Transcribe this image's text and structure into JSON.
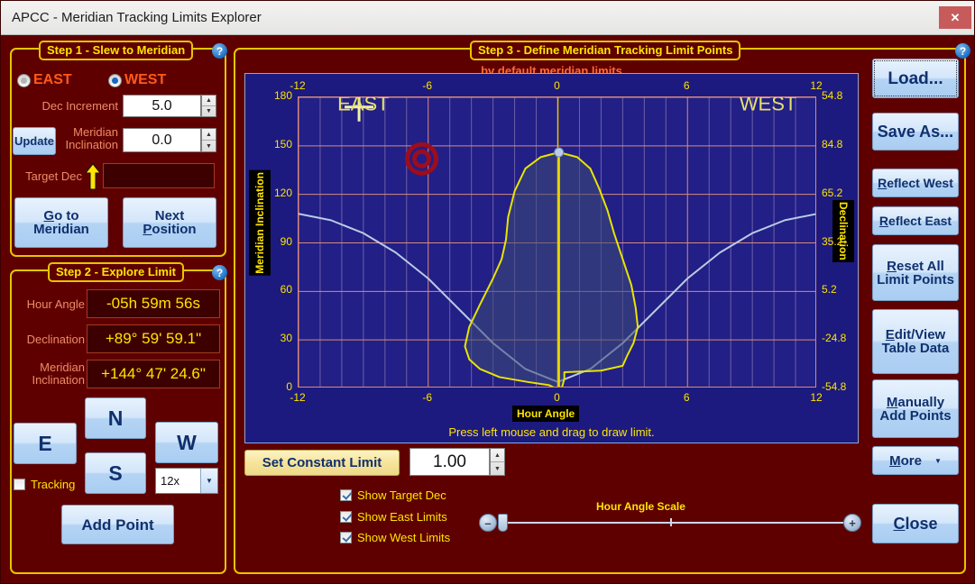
{
  "window": {
    "title": "APCC - Meridian Tracking Limits Explorer",
    "close_label": "✕"
  },
  "step1": {
    "legend": "Step 1 - Slew to Meridian",
    "help": "?",
    "east_label": "EAST",
    "west_label": "WEST",
    "selected_side": "WEST",
    "dec_increment_label": "Dec Increment",
    "dec_increment_value": "5.0",
    "update_label": "Update",
    "meridian_inclination_label_1": "Meridian",
    "meridian_inclination_label_2": "Inclination",
    "meridian_inclination_value": "0.0",
    "target_dec_label": "Target Dec",
    "target_dec_value": "",
    "goto_meridian_line1": "Go to",
    "goto_meridian_line2": "Meridian",
    "next_position_line1": "Next",
    "next_position_line2": "Position"
  },
  "step2": {
    "legend": "Step 2 - Explore Limit",
    "help": "?",
    "hour_angle_label": "Hour Angle",
    "hour_angle_value": "-05h 59m 56s",
    "declination_label": "Declination",
    "declination_value": "+89° 59' 59.1\"",
    "meridian_inclination_label_1": "Meridian",
    "meridian_inclination_label_2": "Inclination",
    "meridian_inclination_value": "+144° 47' 24.6\"",
    "north_label": "N",
    "south_label": "S",
    "east_label": "E",
    "west_label": "W",
    "tracking_label": "Tracking",
    "tracking_checked": false,
    "rate_value": "12x",
    "add_point_label": "Add Point"
  },
  "step3": {
    "legend": "Step 3 - Define Meridian Tracking Limit Points",
    "help": "?",
    "subtitle": "bv default meridian limits",
    "hint": "Press left mouse and drag to draw limit.",
    "set_constant_limit_label": "Set Constant Limit",
    "constant_limit_value": "1.00",
    "checkboxes": [
      {
        "label": "Show Target Dec",
        "checked": true
      },
      {
        "label": "Show East Limits",
        "checked": true
      },
      {
        "label": "Show West Limits",
        "checked": true
      }
    ],
    "slider_label": "Hour Angle Scale",
    "slider_minus": "–",
    "slider_plus": "+"
  },
  "side_buttons": [
    {
      "name": "load",
      "label": "Load...",
      "focused": true
    },
    {
      "name": "save-as",
      "label": "Save As...",
      "focused": false
    },
    {
      "name": "reflect-west",
      "label": "Reflect West",
      "focused": false
    },
    {
      "name": "reflect-east",
      "label": "Reflect East",
      "focused": false
    },
    {
      "name": "reset-all-limit-points",
      "label": "Reset All\nLimit Points",
      "focused": false
    },
    {
      "name": "edit-view-table-data",
      "label": "Edit/View\nTable Data",
      "focused": false
    },
    {
      "name": "manually-add-points",
      "label": "Manually\nAdd Points",
      "focused": false
    }
  ],
  "more_label": "More",
  "close_label": "Close",
  "chart_data": {
    "type": "line",
    "title": "",
    "xlabel": "Hour Angle",
    "ylabel": "Meridian Inclination",
    "y2label": "Declination",
    "xlim": [
      -12,
      12
    ],
    "ylim": [
      0,
      180
    ],
    "xticks": [
      -12,
      -6,
      0,
      6,
      12
    ],
    "xticklabels": [
      "-12",
      "-6",
      "0",
      "6",
      "12"
    ],
    "xticks_top": [
      -12,
      -6,
      0,
      6,
      12
    ],
    "xticklabels_top": [
      "-12",
      "-6",
      "0",
      "6",
      "12"
    ],
    "yticks": [
      0,
      30,
      60,
      90,
      120,
      150,
      180
    ],
    "yticklabels": [
      "0",
      "30",
      "60",
      "90",
      "120",
      "150",
      "180"
    ],
    "y2ticklabels": [
      "54.8",
      "84.8",
      "65.2",
      "35.2",
      "5.2",
      "-24.8",
      "-54.8"
    ],
    "grid": true,
    "region_labels": [
      {
        "text": "EAST",
        "x": -10.2,
        "y": 172
      },
      {
        "text": "WEST",
        "x": 8.4,
        "y": 172
      }
    ],
    "markers": [
      {
        "name": "target-marker",
        "x": -6.3,
        "y": 142,
        "color": "#9b0d1e",
        "style": "concentric-circles"
      },
      {
        "name": "cursor-crosshair",
        "x": -9.2,
        "y": 174,
        "color": "#f2f0a8",
        "style": "crosshair"
      },
      {
        "name": "apex-point",
        "x": 0.05,
        "y": 146,
        "color": "#b9cde8",
        "style": "dot"
      }
    ],
    "series": [
      {
        "name": "declination-curve",
        "color": "#b9cbe4",
        "x": [
          -12,
          -10.5,
          -9,
          -7.5,
          -6,
          -4.5,
          -3,
          -1.5,
          0,
          1.5,
          3,
          4.5,
          6,
          7.5,
          9,
          10.5,
          12
        ],
        "y": [
          108,
          104,
          96,
          84,
          68,
          48,
          28,
          12,
          4,
          12,
          28,
          48,
          68,
          84,
          96,
          104,
          108
        ]
      },
      {
        "name": "west-limit-polygon",
        "color": "#e8e400",
        "fill": "#3d4b76",
        "closed": true,
        "x": [
          0.05,
          0.9,
          1.5,
          1.9,
          2.3,
          2.6,
          3.0,
          3.4,
          3.6,
          3.7,
          3.5,
          3.2,
          3.0,
          2.0,
          0.3,
          0.3,
          0.2,
          0.05
        ],
        "y": [
          146,
          143,
          136,
          124,
          110,
          96,
          80,
          64,
          50,
          38,
          28,
          20,
          14,
          11,
          10,
          6,
          1,
          0
        ]
      },
      {
        "name": "east-limit-polygon",
        "color": "#e8e400",
        "fill": "#3d4b76",
        "closed": true,
        "x": [
          0.05,
          -0.8,
          -1.5,
          -2.0,
          -2.3,
          -2.4,
          -2.6,
          -3.0,
          -3.6,
          -4.1,
          -4.3,
          -4.1,
          -3.6,
          -2.7,
          -1.4,
          -0.4,
          -0.1,
          0.05
        ],
        "y": [
          146,
          143,
          136,
          122,
          106,
          92,
          80,
          68,
          52,
          38,
          26,
          18,
          12,
          7,
          4,
          2,
          0,
          0
        ]
      },
      {
        "name": "meridian-vertical-line",
        "color": "#e8c400",
        "x": [
          0,
          0
        ],
        "y": [
          0,
          180
        ]
      }
    ]
  }
}
